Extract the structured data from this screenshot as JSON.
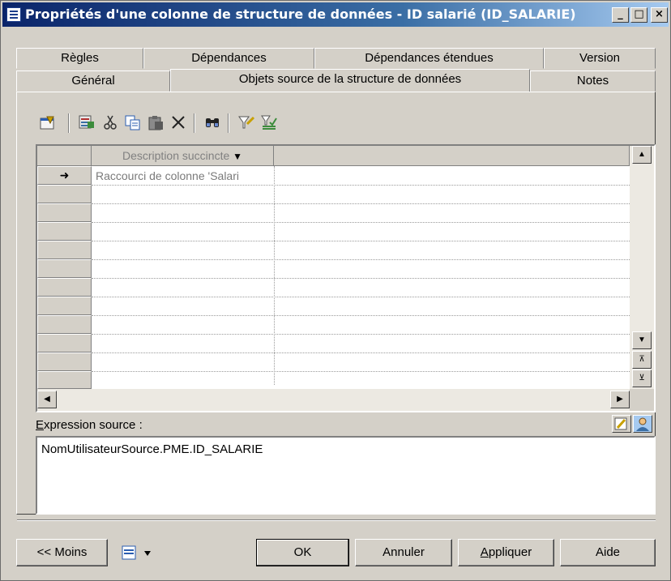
{
  "window": {
    "title": "Propriétés d'une colonne de structure de données - ID salarié (ID_SALARIE)",
    "minimize": "_",
    "maximize": "□",
    "close": "×"
  },
  "tabs": {
    "row_top": [
      "Règles",
      "Dépendances",
      "Dépendances étendues",
      "Version"
    ],
    "row_bottom": [
      "Général",
      "Objets source de la structure de données",
      "Notes"
    ],
    "active": "Objets source de la structure de données"
  },
  "toolbar": {
    "icons": [
      "properties-icon",
      "add-objects-icon",
      "cut-icon",
      "copy-icon",
      "paste-icon",
      "delete-icon",
      "find-icon",
      "filter-icon",
      "customize-columns-icon"
    ]
  },
  "grid": {
    "column_header": "Description succincte",
    "rows": [
      {
        "marker": "➜",
        "description": "Raccourci de colonne 'Salari"
      }
    ],
    "empty_rows": 11
  },
  "expression": {
    "label": "Expression source :",
    "label_accesskey": "E",
    "value": "NomUtilisateurSource.PME.ID_SALARIE"
  },
  "buttons": {
    "less": "<< Moins",
    "ok": "OK",
    "cancel": "Annuler",
    "apply": "Appliquer",
    "apply_accesskey": "A",
    "help": "Aide"
  },
  "colors": {
    "face": "#d4d0c8",
    "title_start": "#0a246a",
    "title_end": "#a6caf0"
  }
}
